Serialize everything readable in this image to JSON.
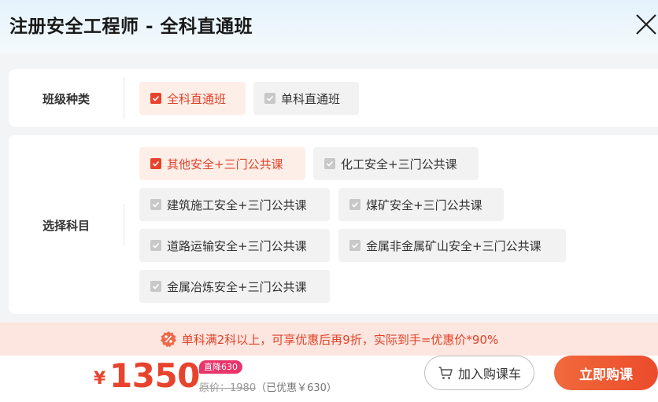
{
  "header": {
    "title": "注册安全工程师 - 全科直通班"
  },
  "class_type": {
    "label": "班级种类",
    "options": [
      {
        "label": "全科直通班",
        "selected": true
      },
      {
        "label": "单科直通班",
        "selected": false
      }
    ]
  },
  "subjects": {
    "label": "选择科目",
    "options": [
      {
        "label": "其他安全+三门公共课",
        "selected": true
      },
      {
        "label": "化工安全+三门公共课",
        "selected": false
      },
      {
        "label": "建筑施工安全+三门公共课",
        "selected": false
      },
      {
        "label": "煤矿安全+三门公共课",
        "selected": false
      },
      {
        "label": "道路运输安全+三门公共课",
        "selected": false
      },
      {
        "label": "金属非金属矿山安全+三门公共课",
        "selected": false
      },
      {
        "label": "金属冶炼安全+三门公共课",
        "selected": false
      }
    ]
  },
  "promo": {
    "text": "单科满2科以上，可享优惠后再9折，实际到手=优惠价*90%"
  },
  "footer": {
    "currency": "¥",
    "price": "1350",
    "discount_tag": "直降630",
    "original_label": "原价：",
    "original_price": "1980",
    "saved_text": "（已优惠￥630）",
    "cart_label": "加入购课车",
    "buy_label": "立即购课"
  },
  "colors": {
    "accent": "#e8432c",
    "selected_bg": "#fdeee7",
    "promo_bg": "#fde6df",
    "tag": "#e8356b"
  }
}
